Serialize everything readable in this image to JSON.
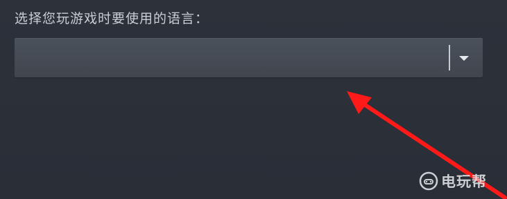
{
  "language_prompt": {
    "label": "选择您玩游戏时要使用的语言：",
    "selected_value": ""
  },
  "annotation": {
    "arrow_color": "#ff1a1a"
  },
  "watermark": {
    "text": "电玩帮"
  },
  "colors": {
    "background": "#2b2f38",
    "select_background": "#464b55",
    "label_text": "#c9ced6"
  }
}
